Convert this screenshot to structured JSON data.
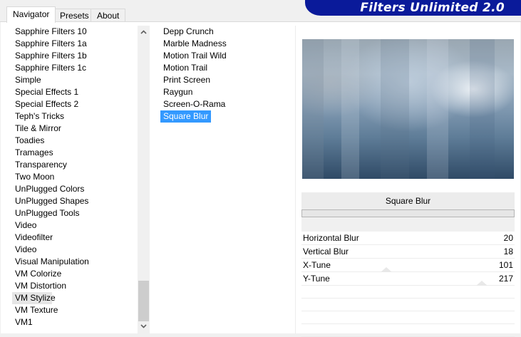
{
  "tabs": [
    {
      "label": "Navigator"
    },
    {
      "label": "Presets"
    },
    {
      "label": "About"
    }
  ],
  "banner": {
    "title": "Filters Unlimited 2.0"
  },
  "categories": [
    "Sapphire Filters 10",
    "Sapphire Filters 1a",
    "Sapphire Filters 1b",
    "Sapphire Filters 1c",
    "Simple",
    "Special Effects 1",
    "Special Effects 2",
    "Teph's Tricks",
    "Tile & Mirror",
    "Toadies",
    "Tramages",
    "Transparency",
    "Two Moon",
    "UnPlugged Colors",
    "UnPlugged Shapes",
    "UnPlugged Tools",
    "Video",
    "Videofilter",
    "Video",
    "Visual Manipulation",
    "VM Colorize",
    "VM Distortion",
    "VM Stylize",
    "VM Texture",
    "VM1"
  ],
  "selected_category": "VM Stylize",
  "filters": [
    "Depp Crunch",
    "Marble Madness",
    "Motion Trail Wild",
    "Motion Trail",
    "Print Screen",
    "Raygun",
    "Screen-O-Rama",
    "Square Blur"
  ],
  "selected_filter": "Square Blur",
  "panel": {
    "filter_title": "Square Blur",
    "params": [
      {
        "name": "Horizontal Blur",
        "value": "20"
      },
      {
        "name": "Vertical Blur",
        "value": "18"
      },
      {
        "name": "X-Tune",
        "value": "101"
      },
      {
        "name": "Y-Tune",
        "value": "217"
      }
    ]
  },
  "scroll": {
    "up_icon": "chevron-up-icon",
    "down_icon": "chevron-down-icon"
  },
  "colors": {
    "selection": "#3399ff",
    "banner": "#0a1a9a"
  }
}
